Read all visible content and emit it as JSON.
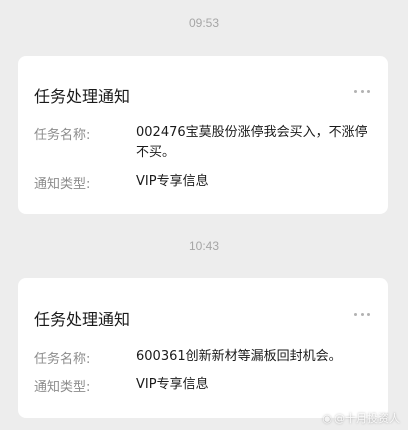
{
  "messages": [
    {
      "time": "09:53",
      "title": "任务处理通知",
      "fields": [
        {
          "label": "任务名称:",
          "value": "002476宝莫股份涨停我会买入，不涨停不买。"
        },
        {
          "label": "通知类型:",
          "value": "VIP专享信息"
        }
      ]
    },
    {
      "time": "10:43",
      "title": "任务处理通知",
      "fields": [
        {
          "label": "任务名称:",
          "value": "600361创新新材等漏板回封机会。"
        },
        {
          "label": "通知类型:",
          "value": "VIP专享信息"
        }
      ]
    }
  ],
  "watermark": {
    "icon": "weibo-icon",
    "text": "@十月投资人"
  },
  "colors": {
    "background": "#ededed",
    "card": "#ffffff",
    "timestamp": "#a6a6a6",
    "label": "#8c8c8c",
    "text": "#1a1a1a"
  }
}
